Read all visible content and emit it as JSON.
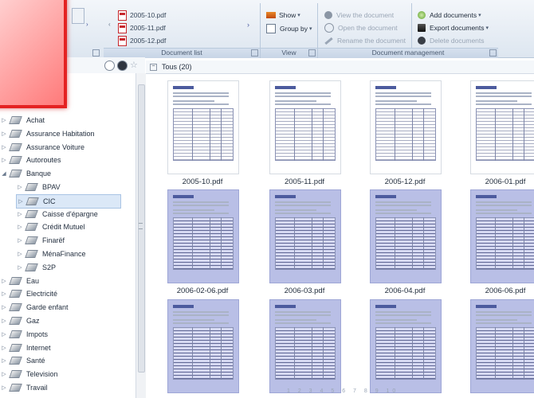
{
  "ribbon": {
    "document_list": {
      "label": "Document list",
      "items": [
        "2005-10.pdf",
        "2005-11.pdf",
        "2005-12.pdf"
      ]
    },
    "view": {
      "label": "View",
      "show": "Show",
      "group_by": "Group by"
    },
    "document_management": {
      "label": "Document management",
      "view_document": "View the document",
      "open_document": "Open the document",
      "rename_document": "Rename the document",
      "add_documents": "Add documents",
      "export_documents": "Export documents",
      "delete_documents": "Delete documents"
    }
  },
  "tree": {
    "items": [
      {
        "label": "Achat",
        "level": 0
      },
      {
        "label": "Assurance Habitation",
        "level": 0
      },
      {
        "label": "Assurance Voiture",
        "level": 0
      },
      {
        "label": "Autoroutes",
        "level": 0
      },
      {
        "label": "Banque",
        "level": 0,
        "expanded": true
      },
      {
        "label": "BPAV",
        "level": 1
      },
      {
        "label": "CIC",
        "level": 1,
        "selected": true
      },
      {
        "label": "Caisse d'épargne",
        "level": 1
      },
      {
        "label": "Crédit Mutuel",
        "level": 1
      },
      {
        "label": "Finarëf",
        "level": 1
      },
      {
        "label": "MénaFinance",
        "level": 1
      },
      {
        "label": "S2P",
        "level": 1
      },
      {
        "label": "Eau",
        "level": 0
      },
      {
        "label": "Electricité",
        "level": 0
      },
      {
        "label": "Garde enfant",
        "level": 0
      },
      {
        "label": "Gaz",
        "level": 0
      },
      {
        "label": "Impots",
        "level": 0
      },
      {
        "label": "Internet",
        "level": 0
      },
      {
        "label": "Santé",
        "level": 0
      },
      {
        "label": "Television",
        "level": 0
      },
      {
        "label": "Travail",
        "level": 0
      }
    ]
  },
  "grid": {
    "header": "Tous (20)",
    "rows": [
      {
        "names": [
          "2005-10.pdf",
          "2005-11.pdf",
          "2005-12.pdf",
          "2006-01.pdf"
        ],
        "style": "white"
      },
      {
        "names": [
          "2006-02-06.pdf",
          "2006-03.pdf",
          "2006-04.pdf",
          "2006-06.pdf"
        ],
        "style": "blue"
      },
      {
        "names": [
          "",
          "",
          "",
          ""
        ],
        "style": "blue"
      }
    ]
  },
  "pager": "1 2 3 4 5 6 7 8 9 10",
  "colors": {
    "highlight_red": "#e42222",
    "pdf_red": "#c7262b",
    "selection": "#dbe8f7"
  }
}
